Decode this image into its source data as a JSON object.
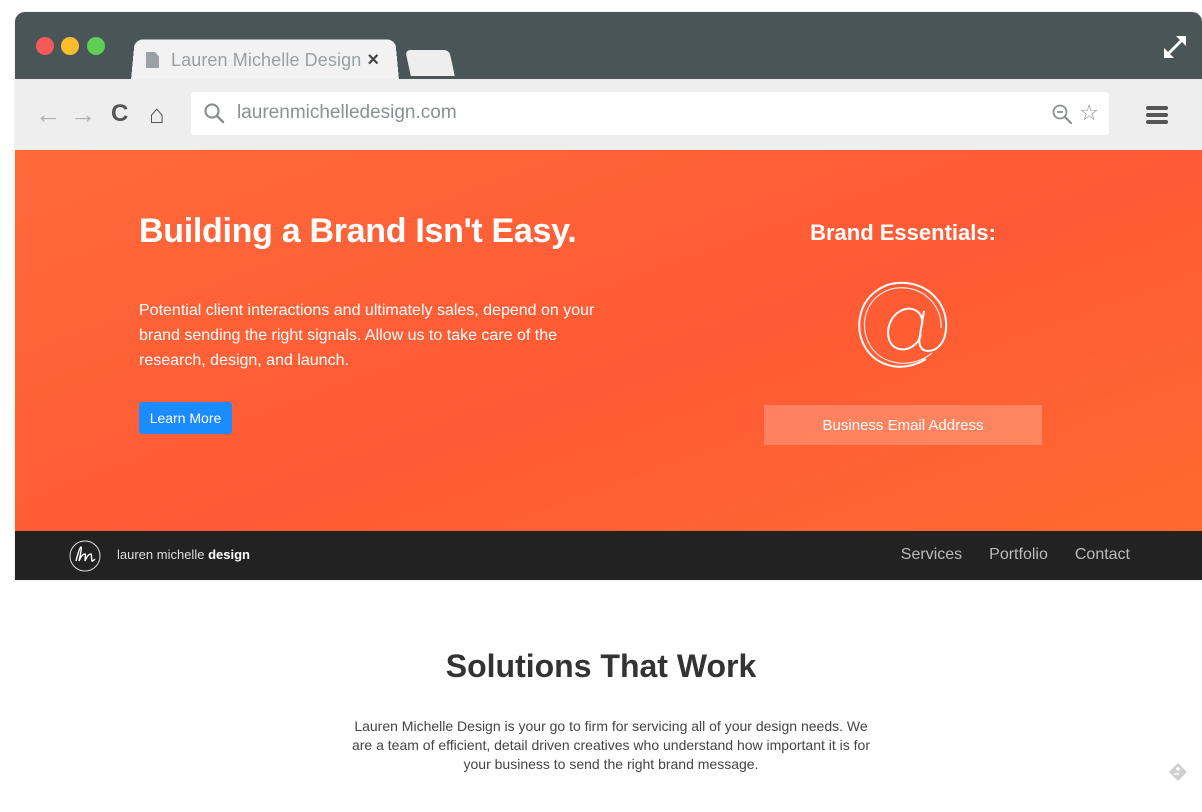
{
  "browser": {
    "tab_title": "Lauren Michelle Design",
    "tab_close": "×",
    "url": "laurenmichelledesign.com",
    "nav": {
      "back": "←",
      "forward": "→",
      "reload": "C",
      "home": "⌂",
      "star": "☆"
    }
  },
  "hero": {
    "heading": "Building a Brand Isn't Easy.",
    "description": "Potential client interactions and ultimately sales, depend on your brand sending the right signals. Allow us to take care of the research, design, and launch.",
    "button_label": "Learn More",
    "essentials_title": "Brand Essentials:",
    "email_placeholder": "Business Email Address"
  },
  "site_nav": {
    "logo_text_light": "lauren michelle",
    "logo_text_bold": "design",
    "links": [
      "Services",
      "Portfolio",
      "Contact"
    ]
  },
  "solutions": {
    "title": "Solutions That Work",
    "body": "Lauren Michelle Design is your go to firm for servicing all of your design needs. We are a team of efficient, detail driven creatives who understand how important it is for your business to send the right brand message."
  },
  "colors": {
    "hero_orange": "#ff5a35",
    "nav_dark": "#222222",
    "button_blue": "#1a8cff",
    "titlebar": "#4a5558"
  }
}
